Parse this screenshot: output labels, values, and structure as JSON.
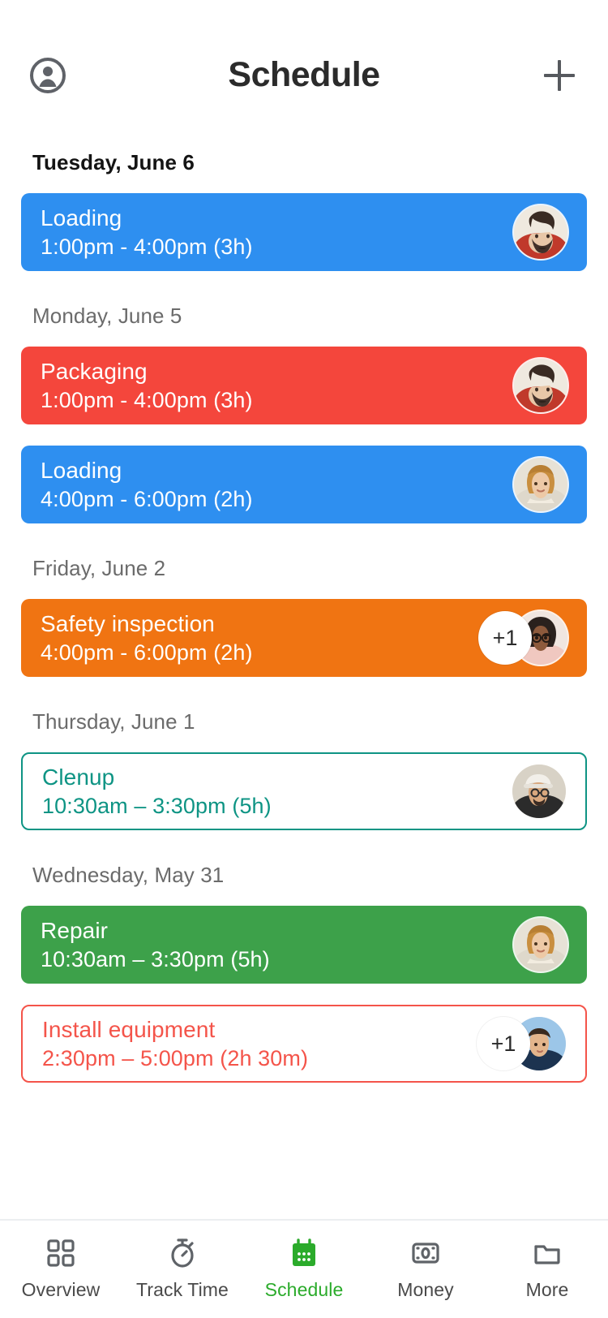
{
  "header": {
    "title": "Schedule",
    "profile_icon": "profile-circle-icon",
    "add_icon": "plus-icon"
  },
  "colors": {
    "blue": "#2E8FF0",
    "red": "#F4463C",
    "orange": "#F07412",
    "teal": "#0E9484",
    "green": "#3DA14A",
    "red_outline": "#F4544A",
    "active_nav": "#2bab2b",
    "day_label": "#6b6b6b",
    "today_label": "#141414"
  },
  "days": [
    {
      "label": "Tuesday, June 6",
      "is_today": true,
      "events": [
        {
          "title": "Loading",
          "time": "1:00pm - 4:00pm (3h)",
          "style": "filled",
          "color": "#2E8FF0",
          "avatar": "bearded-man-avatar",
          "extra_count": null
        }
      ]
    },
    {
      "label": "Monday, June 5",
      "is_today": false,
      "events": [
        {
          "title": "Packaging",
          "time": "1:00pm - 4:00pm (3h)",
          "style": "filled",
          "color": "#F4463C",
          "avatar": "bearded-man-avatar",
          "extra_count": null
        },
        {
          "title": "Loading",
          "time": "4:00pm - 6:00pm (2h)",
          "style": "filled",
          "color": "#2E8FF0",
          "avatar": "curly-blonde-woman-avatar",
          "extra_count": null
        }
      ]
    },
    {
      "label": "Friday, June 2",
      "is_today": false,
      "events": [
        {
          "title": "Safety inspection",
          "time": "4:00pm - 6:00pm (2h)",
          "style": "filled",
          "color": "#F07412",
          "avatar": "curly-dark-haired-woman-avatar",
          "extra_count": "+1"
        }
      ]
    },
    {
      "label": "Thursday, June 1",
      "is_today": false,
      "events": [
        {
          "title": "Clenup",
          "time": "10:30am – 3:30pm (5h)",
          "style": "outlined",
          "color": "#0E9484",
          "avatar": "man-with-cap-avatar",
          "extra_count": null
        }
      ]
    },
    {
      "label": "Wednesday, May 31",
      "is_today": false,
      "events": [
        {
          "title": "Repair",
          "time": "10:30am – 3:30pm (5h)",
          "style": "filled",
          "color": "#3DA14A",
          "avatar": "curly-blonde-woman-avatar",
          "extra_count": null
        },
        {
          "title": "Install equipment",
          "time": "2:30pm – 5:00pm (2h 30m)",
          "style": "outlined",
          "color": "#F4544A",
          "avatar": "short-hair-man-avatar",
          "extra_count": "+1"
        }
      ]
    }
  ],
  "bottom_nav": {
    "items": [
      {
        "label": "Overview",
        "icon": "grid-icon",
        "active": false
      },
      {
        "label": "Track Time",
        "icon": "stopwatch-icon",
        "active": false
      },
      {
        "label": "Schedule",
        "icon": "calendar-icon",
        "active": true
      },
      {
        "label": "Money",
        "icon": "banknote-icon",
        "active": false
      },
      {
        "label": "More",
        "icon": "folder-icon",
        "active": false
      }
    ]
  }
}
